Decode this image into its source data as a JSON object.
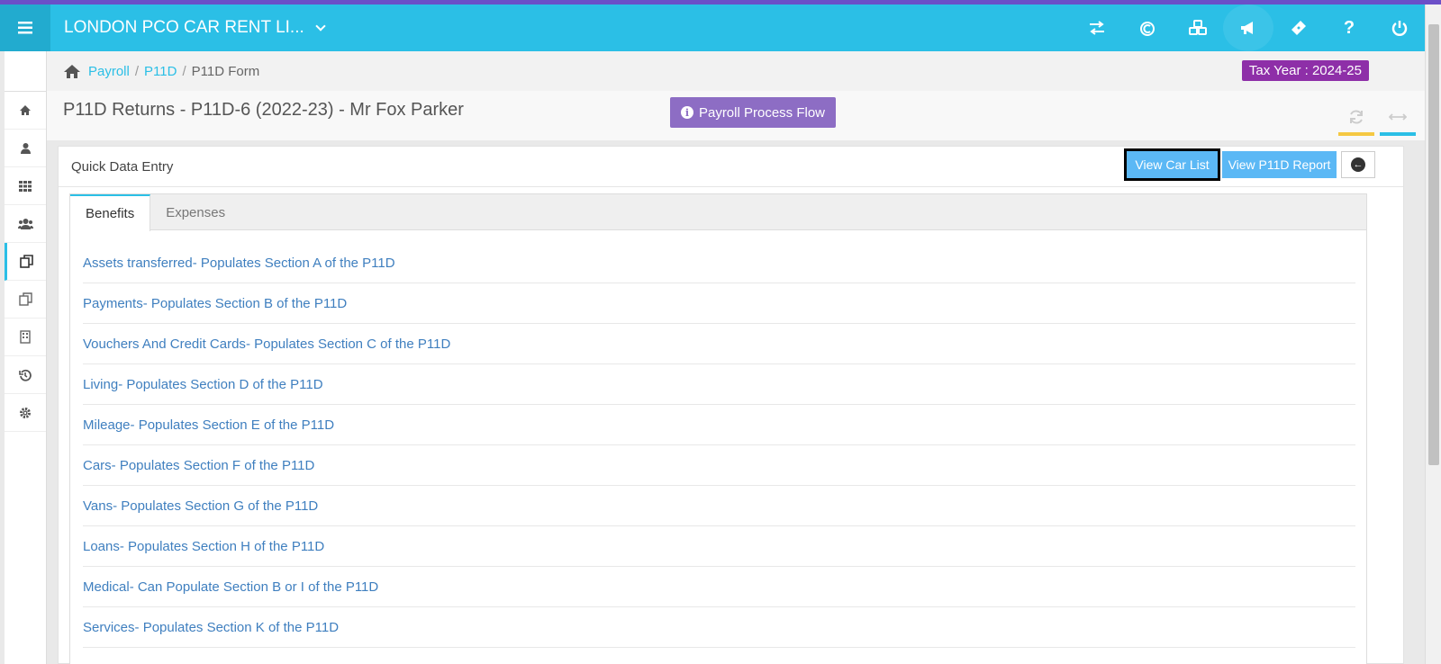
{
  "header": {
    "company": "LONDON PCO CAR RENT LI...",
    "icons": [
      "exchange-icon",
      "currency-icon",
      "cubes-icon",
      "bullhorn-icon",
      "ticket-icon",
      "question-icon",
      "power-icon"
    ]
  },
  "sidebar": {
    "items": [
      "home-icon",
      "user-icon",
      "grid-icon",
      "users-icon",
      "copy-icon",
      "copy-outline-icon",
      "building-icon",
      "history-icon",
      "gear-icon"
    ]
  },
  "breadcrumb": {
    "payroll": "Payroll",
    "p11d": "P11D",
    "current": "P11D Form",
    "sep": "/"
  },
  "tax_year": "Tax Year : 2024-25",
  "page": {
    "title": "P11D Returns - P11D-6 (2022-23) - Mr Fox Parker",
    "flow_button": "Payroll Process Flow",
    "info_glyph": "i"
  },
  "panel": {
    "title": "Quick Data Entry",
    "view_car_list": "View Car List",
    "view_p11d_report": "View P11D Report"
  },
  "tabs": [
    "Benefits",
    "Expenses"
  ],
  "benefits": [
    {
      "name": "Assets transferred",
      "desc": " - Populates Section A of the P11D"
    },
    {
      "name": "Payments",
      "desc": " - Populates Section B of the P11D"
    },
    {
      "name": "Vouchers And Credit Cards",
      "desc": " - Populates Section C of the P11D"
    },
    {
      "name": "Living",
      "desc": " - Populates Section D of the P11D"
    },
    {
      "name": "Mileage",
      "desc": " - Populates Section E of the P11D"
    },
    {
      "name": "Cars",
      "desc": " - Populates Section F of the P11D"
    },
    {
      "name": "Vans",
      "desc": " - Populates Section G of the P11D"
    },
    {
      "name": "Loans",
      "desc": " - Populates Section H of the P11D"
    },
    {
      "name": "Medical",
      "desc": " - Can Populate Section B or I of the P11D"
    },
    {
      "name": "Services",
      "desc": " - Populates Section K of the P11D"
    }
  ]
}
